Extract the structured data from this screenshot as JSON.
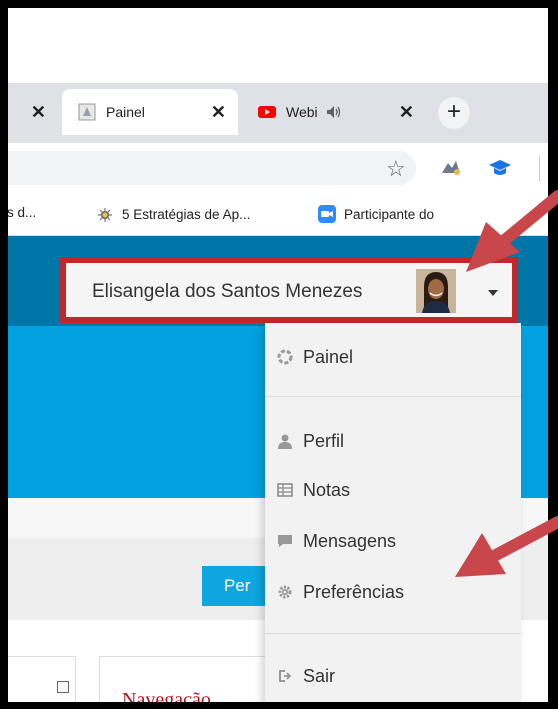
{
  "browser": {
    "tabs": [
      {
        "label": "",
        "close": "✕"
      },
      {
        "label": "Painel",
        "close": "✕"
      },
      {
        "label": "Webi",
        "close": "✕"
      }
    ],
    "new_tab": "+",
    "bookmarks": [
      {
        "label": "is d..."
      },
      {
        "label": "5 Estratégias de Ap..."
      },
      {
        "label": "Participante do"
      }
    ]
  },
  "user_menu": {
    "name": "Elisangela dos Santos Menezes",
    "items": {
      "painel": "Painel",
      "perfil": "Perfil",
      "notas": "Notas",
      "mensagens": "Mensagens",
      "preferencias": "Preferências",
      "sair": "Sair"
    }
  },
  "page": {
    "button_partial": "Per",
    "navigation_title": "Navegação"
  },
  "colors": {
    "accent_blue": "#00a1e0",
    "header_blue": "#0076a8",
    "highlight_red": "#c0282d",
    "arrow_red": "#c9464b"
  }
}
